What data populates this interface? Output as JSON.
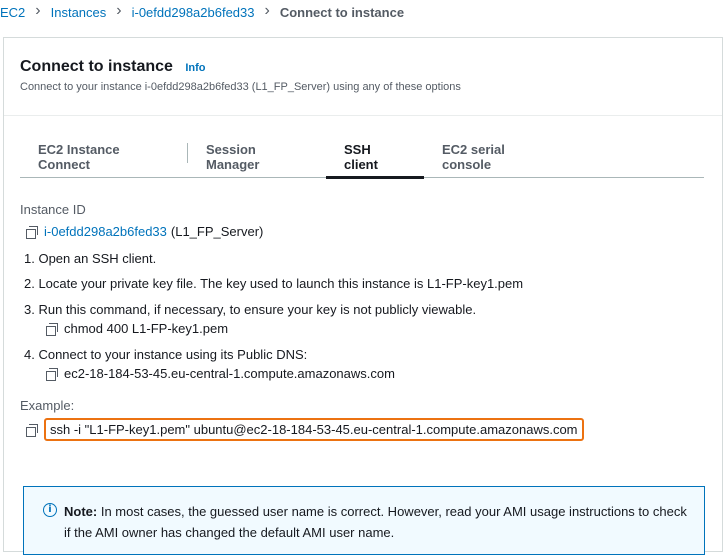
{
  "breadcrumb": {
    "items": [
      "EC2",
      "Instances",
      "i-0efdd298a2b6fed33"
    ],
    "current": "Connect to instance",
    "separator": "›"
  },
  "header": {
    "title": "Connect to instance",
    "info": "Info",
    "subtitle": "Connect to your instance i-0efdd298a2b6fed33 (L1_FP_Server) using any of these options"
  },
  "tabs": [
    {
      "label": "EC2 Instance Connect"
    },
    {
      "label": "Session Manager"
    },
    {
      "label": "SSH client"
    },
    {
      "label": "EC2 serial console"
    }
  ],
  "active_tab": "SSH client",
  "instance": {
    "label": "Instance ID",
    "id": "i-0efdd298a2b6fed33",
    "name": "(L1_FP_Server)"
  },
  "steps": {
    "s1": "1. Open an SSH client.",
    "s2": "2. Locate your private key file. The key used to launch this instance is L1-FP-key1.pem",
    "s3": "3. Run this command, if necessary, to ensure your key is not publicly viewable.",
    "s3_cmd": "chmod 400 L1-FP-key1.pem",
    "s4": "4. Connect to your instance using its Public DNS:",
    "s4_dns": "ec2-18-184-53-45.eu-central-1.compute.amazonaws.com"
  },
  "example": {
    "label": "Example:",
    "command": "ssh -i \"L1-FP-key1.pem\" ubuntu@ec2-18-184-53-45.eu-central-1.compute.amazonaws.com"
  },
  "note": {
    "icon": "info-icon",
    "strong": "Note:",
    "text": " In most cases, the guessed user name is correct. However, read your AMI usage instructions to check if the AMI owner has changed the default AMI user name."
  },
  "colors": {
    "link": "#0073bb",
    "highlight": "#ec7211",
    "note_bg": "#f1faff"
  }
}
